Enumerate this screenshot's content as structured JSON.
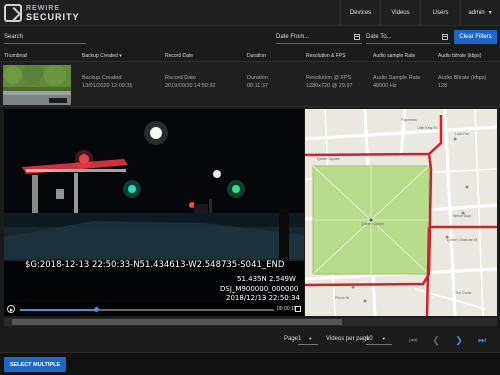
{
  "brand": {
    "line1": "REWIRE",
    "line2": "SECURITY"
  },
  "nav": {
    "devices": "Devices",
    "videos": "Videos",
    "users": "Users",
    "user": "admin"
  },
  "filters": {
    "search_placeholder": "Search",
    "date_from_placeholder": "Date From...",
    "date_to_placeholder": "Date To...",
    "clear_label": "Clear Filters"
  },
  "table": {
    "headers": [
      "Thumbnail",
      "Backup Created",
      "Record Date",
      "Duration",
      "Resolution & FPS",
      "Audio sample Rate",
      "Audio bitrate (kbps)"
    ],
    "sort_indicator": "▾",
    "row": {
      "backup_label": "Backup Created",
      "backup_value": "13/01/2020 12:09:35",
      "record_label": "Record Date",
      "record_value": "2019/09/30 14:50:32",
      "duration_label": "Duration",
      "duration_value": "00:11:37",
      "resolution_label": "Resolution @ FPS",
      "resolution_value": "1280x720 @ 29.97",
      "audio_rate_label": "Audio Sample Rate",
      "audio_rate_value": "48000 Hz",
      "audio_bitrate_label": "Audio Bitrate (kbps)",
      "audio_bitrate_value": "128"
    }
  },
  "video": {
    "overlay_line": "$G:2018-12-13 22:50:33-N51.434613-W2.548735-S041_END",
    "overlay_coords": "51.435N   2.549W",
    "overlay_file": "DSJ_M900000_000000",
    "overlay_time": "2018/12/13 22:50:34",
    "time": "00:00:11",
    "progress": 0.3
  },
  "map": {
    "labels": [
      "Little King St",
      "Lock Pze",
      "Queen Square",
      "Queen Square",
      "Welsh Back",
      "Queen Charlotte St",
      "Prince St",
      "The Grove",
      "Papermks"
    ]
  },
  "pager": {
    "page_label": "Page",
    "page_value": "1",
    "per_page_label": "Videos per page",
    "per_page_value": "10"
  },
  "actions": {
    "select_multiple": "SELECT MULTIPLE"
  },
  "colors": {
    "accent": "#1e66c8",
    "route": "#d0202a",
    "park": "#b8dc8c"
  }
}
